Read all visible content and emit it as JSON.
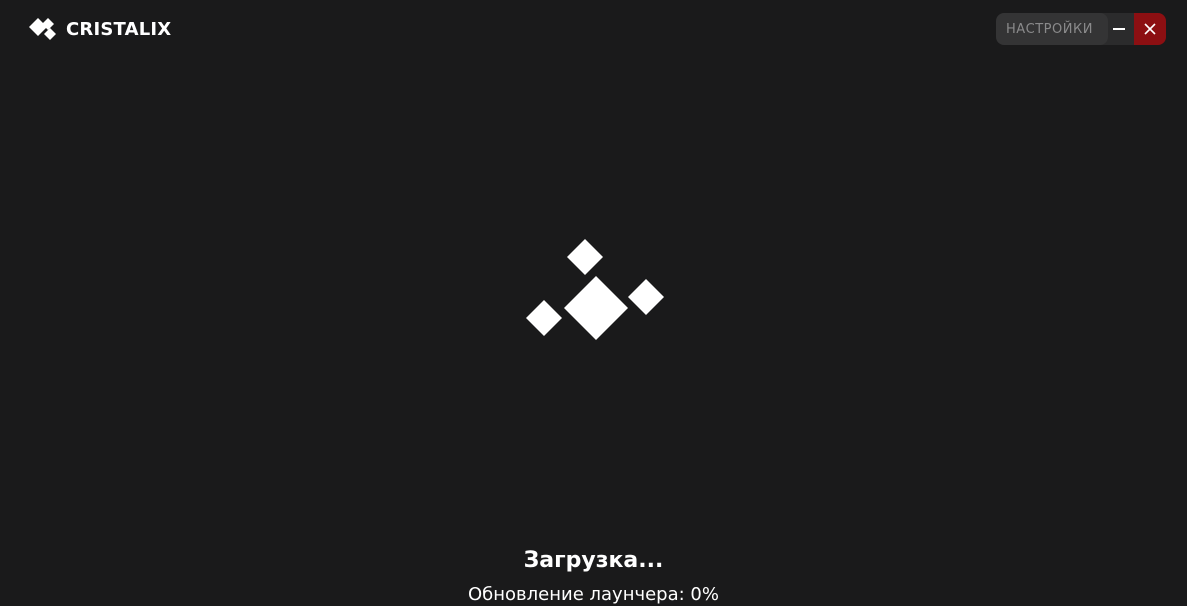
{
  "app": {
    "logo_text": "CRISTALIX",
    "logo_icon": "diamond-cluster-icon"
  },
  "window_controls": {
    "settings_label": "НАСТРОЙКИ",
    "minimize_icon": "minimize-icon",
    "close_icon": "close-icon"
  },
  "loader": {
    "icon": "diamond-spinner-icon"
  },
  "loading": {
    "title": "Загрузка...",
    "status_label": "Обновление лаунчера:",
    "progress": "0%"
  },
  "colors": {
    "background": "#1a1a1b",
    "settings_bg": "#343435",
    "minimize_bg": "#2b2b2c",
    "close_bg": "#8c0f12",
    "foreground": "#ffffff"
  }
}
